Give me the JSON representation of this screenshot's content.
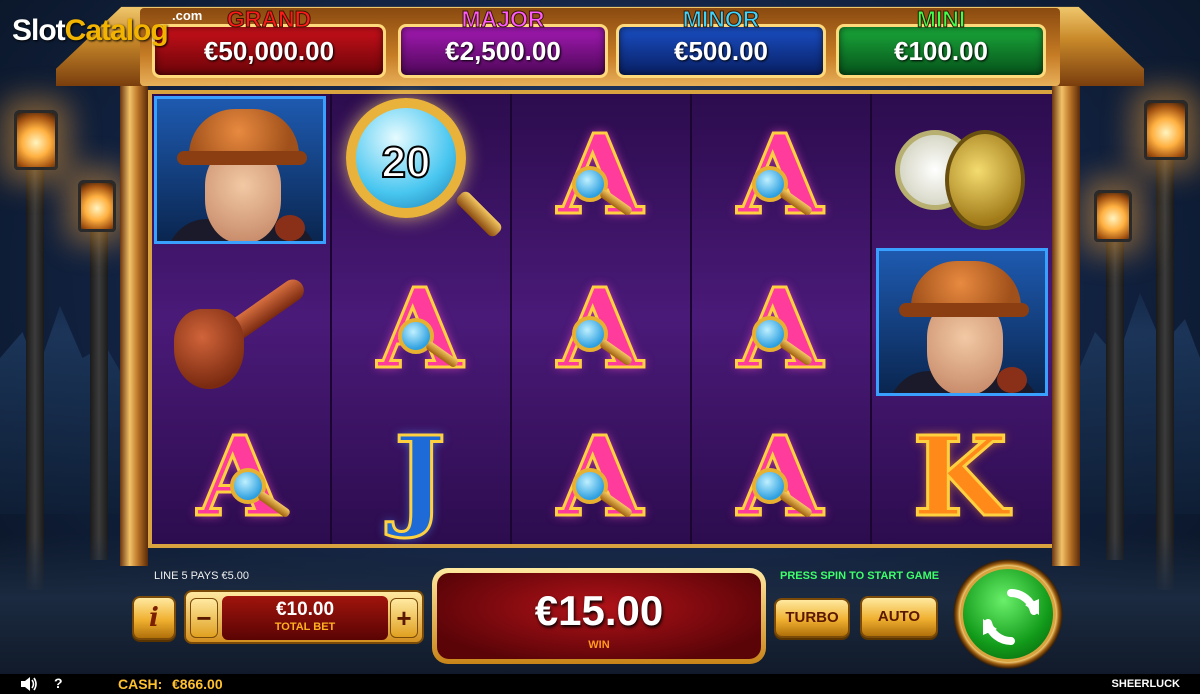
{
  "logo": {
    "part1": "Slot",
    "part2": "Catalog",
    "suffix": ".com"
  },
  "jackpots": {
    "grand": {
      "label": "GRAND",
      "value": "€50,000.00",
      "color": "#ff1a1a"
    },
    "major": {
      "label": "MAJOR",
      "value": "€2,500.00",
      "color": "#ff5cff"
    },
    "minor": {
      "label": "MINOR",
      "value": "€500.00",
      "color": "#3ad6ff"
    },
    "mini": {
      "label": "MINI",
      "value": "€100.00",
      "color": "#3dff4d"
    }
  },
  "reels": [
    [
      "detective-portrait",
      "pipe",
      "A"
    ],
    [
      "bonus-magnifier-20",
      "A",
      "J"
    ],
    [
      "A",
      "A",
      "A"
    ],
    [
      "A",
      "A",
      "A"
    ],
    [
      "pocket-watch",
      "detective-portrait",
      "K"
    ]
  ],
  "symbols": {
    "letter_a": "A",
    "letter_j": "J",
    "letter_k": "K",
    "bonus_value": "20"
  },
  "info": {
    "line_pays": "LINE 5 PAYS €5.00",
    "press_spin": "PRESS SPIN TO START GAME"
  },
  "controls": {
    "info_label": "i",
    "minus_label": "−",
    "plus_label": "+",
    "bet_value": "€10.00",
    "bet_label": "TOTAL BET",
    "win_value": "€15.00",
    "win_label": "WIN",
    "turbo_label": "TURBO",
    "auto_label": "AUTO"
  },
  "footer": {
    "help_label": "?",
    "cash_label": "CASH:",
    "cash_value": "€866.00",
    "game_name": "SHEERLUCK"
  }
}
